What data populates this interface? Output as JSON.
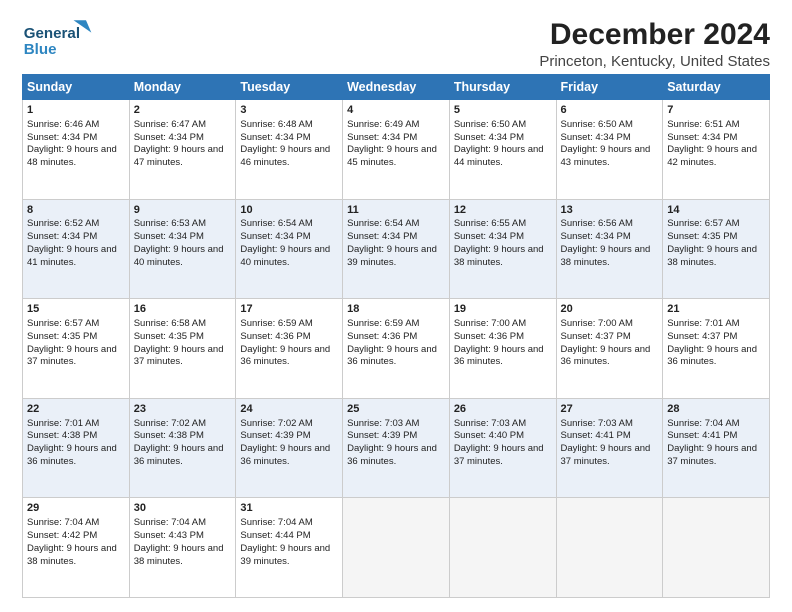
{
  "header": {
    "logo_line1": "General",
    "logo_line2": "Blue",
    "title": "December 2024",
    "subtitle": "Princeton, Kentucky, United States"
  },
  "days_of_week": [
    "Sunday",
    "Monday",
    "Tuesday",
    "Wednesday",
    "Thursday",
    "Friday",
    "Saturday"
  ],
  "weeks": [
    [
      {
        "day": 1,
        "sun": "6:46 AM",
        "set": "4:34 PM",
        "dl": "9 hours and 48 minutes."
      },
      {
        "day": 2,
        "sun": "6:47 AM",
        "set": "4:34 PM",
        "dl": "9 hours and 47 minutes."
      },
      {
        "day": 3,
        "sun": "6:48 AM",
        "set": "4:34 PM",
        "dl": "9 hours and 46 minutes."
      },
      {
        "day": 4,
        "sun": "6:49 AM",
        "set": "4:34 PM",
        "dl": "9 hours and 45 minutes."
      },
      {
        "day": 5,
        "sun": "6:50 AM",
        "set": "4:34 PM",
        "dl": "9 hours and 44 minutes."
      },
      {
        "day": 6,
        "sun": "6:50 AM",
        "set": "4:34 PM",
        "dl": "9 hours and 43 minutes."
      },
      {
        "day": 7,
        "sun": "6:51 AM",
        "set": "4:34 PM",
        "dl": "9 hours and 42 minutes."
      }
    ],
    [
      {
        "day": 8,
        "sun": "6:52 AM",
        "set": "4:34 PM",
        "dl": "9 hours and 41 minutes."
      },
      {
        "day": 9,
        "sun": "6:53 AM",
        "set": "4:34 PM",
        "dl": "9 hours and 40 minutes."
      },
      {
        "day": 10,
        "sun": "6:54 AM",
        "set": "4:34 PM",
        "dl": "9 hours and 40 minutes."
      },
      {
        "day": 11,
        "sun": "6:54 AM",
        "set": "4:34 PM",
        "dl": "9 hours and 39 minutes."
      },
      {
        "day": 12,
        "sun": "6:55 AM",
        "set": "4:34 PM",
        "dl": "9 hours and 38 minutes."
      },
      {
        "day": 13,
        "sun": "6:56 AM",
        "set": "4:34 PM",
        "dl": "9 hours and 38 minutes."
      },
      {
        "day": 14,
        "sun": "6:57 AM",
        "set": "4:35 PM",
        "dl": "9 hours and 38 minutes."
      }
    ],
    [
      {
        "day": 15,
        "sun": "6:57 AM",
        "set": "4:35 PM",
        "dl": "9 hours and 37 minutes."
      },
      {
        "day": 16,
        "sun": "6:58 AM",
        "set": "4:35 PM",
        "dl": "9 hours and 37 minutes."
      },
      {
        "day": 17,
        "sun": "6:59 AM",
        "set": "4:36 PM",
        "dl": "9 hours and 36 minutes."
      },
      {
        "day": 18,
        "sun": "6:59 AM",
        "set": "4:36 PM",
        "dl": "9 hours and 36 minutes."
      },
      {
        "day": 19,
        "sun": "7:00 AM",
        "set": "4:36 PM",
        "dl": "9 hours and 36 minutes."
      },
      {
        "day": 20,
        "sun": "7:00 AM",
        "set": "4:37 PM",
        "dl": "9 hours and 36 minutes."
      },
      {
        "day": 21,
        "sun": "7:01 AM",
        "set": "4:37 PM",
        "dl": "9 hours and 36 minutes."
      }
    ],
    [
      {
        "day": 22,
        "sun": "7:01 AM",
        "set": "4:38 PM",
        "dl": "9 hours and 36 minutes."
      },
      {
        "day": 23,
        "sun": "7:02 AM",
        "set": "4:38 PM",
        "dl": "9 hours and 36 minutes."
      },
      {
        "day": 24,
        "sun": "7:02 AM",
        "set": "4:39 PM",
        "dl": "9 hours and 36 minutes."
      },
      {
        "day": 25,
        "sun": "7:03 AM",
        "set": "4:39 PM",
        "dl": "9 hours and 36 minutes."
      },
      {
        "day": 26,
        "sun": "7:03 AM",
        "set": "4:40 PM",
        "dl": "9 hours and 37 minutes."
      },
      {
        "day": 27,
        "sun": "7:03 AM",
        "set": "4:41 PM",
        "dl": "9 hours and 37 minutes."
      },
      {
        "day": 28,
        "sun": "7:04 AM",
        "set": "4:41 PM",
        "dl": "9 hours and 37 minutes."
      }
    ],
    [
      {
        "day": 29,
        "sun": "7:04 AM",
        "set": "4:42 PM",
        "dl": "9 hours and 38 minutes."
      },
      {
        "day": 30,
        "sun": "7:04 AM",
        "set": "4:43 PM",
        "dl": "9 hours and 38 minutes."
      },
      {
        "day": 31,
        "sun": "7:04 AM",
        "set": "4:44 PM",
        "dl": "9 hours and 39 minutes."
      },
      null,
      null,
      null,
      null
    ]
  ]
}
